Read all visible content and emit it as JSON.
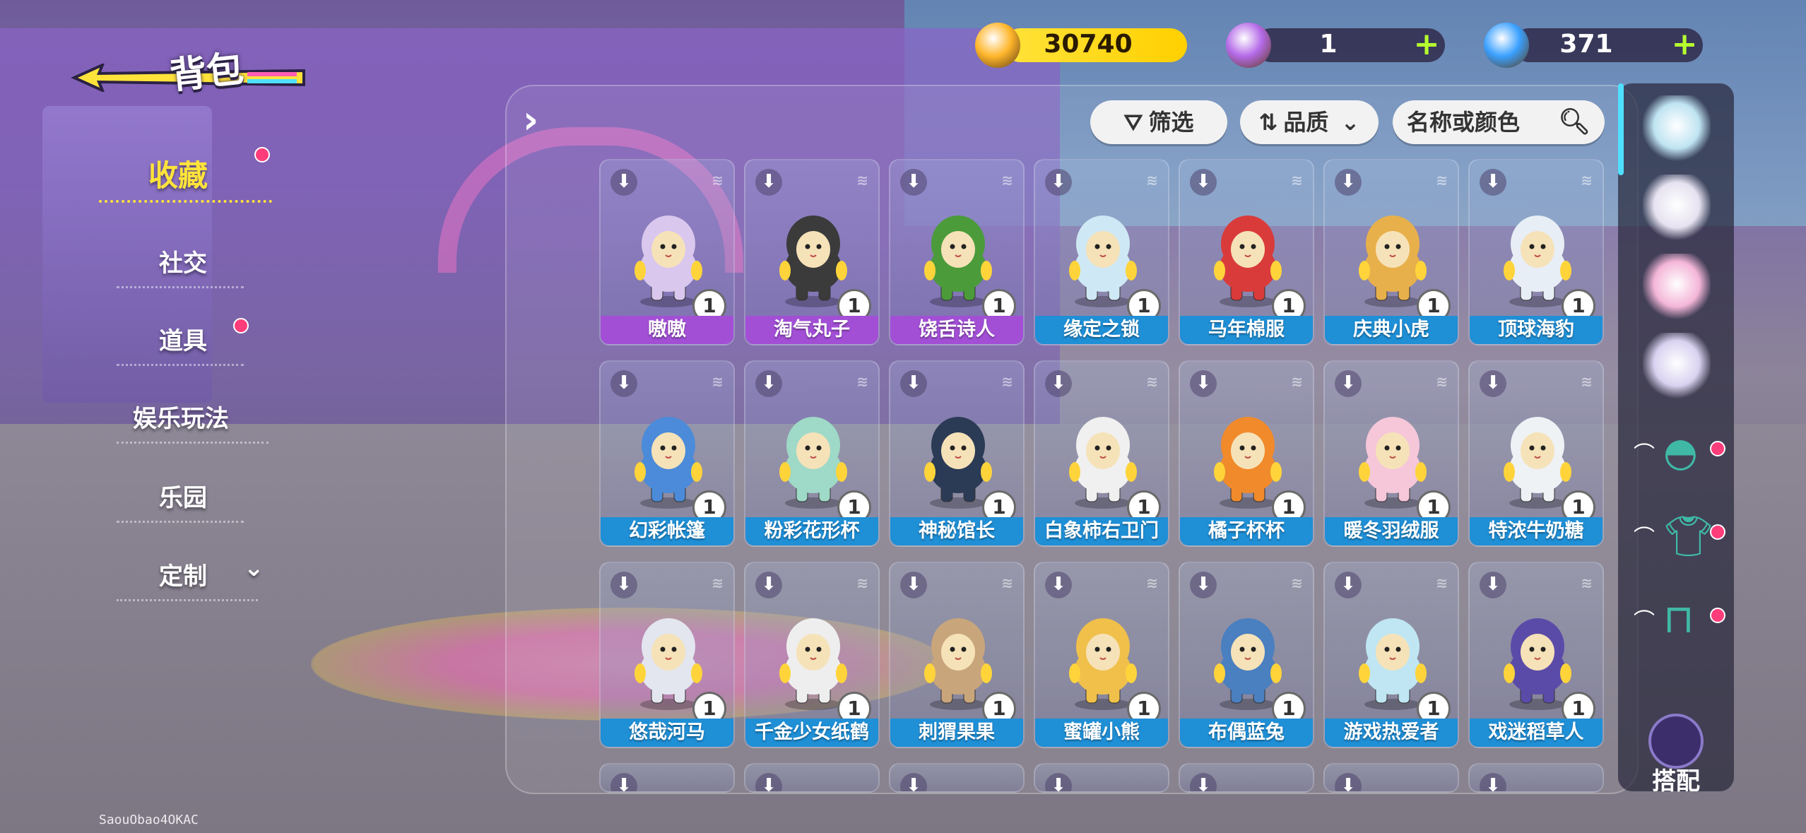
{
  "header": {
    "back_title": "背包",
    "currencies": [
      {
        "icon": "gold-star-coin-icon",
        "value": "30740",
        "has_plus": false
      },
      {
        "icon": "purple-token-icon",
        "value": "1",
        "has_plus": true,
        "plus": "+"
      },
      {
        "icon": "blue-gem-icon",
        "value": "371",
        "has_plus": true,
        "plus": "+"
      }
    ]
  },
  "sidebar": {
    "items": [
      {
        "label": "收藏",
        "selected": true,
        "badge": true
      },
      {
        "label": "社交",
        "selected": false,
        "badge": false
      },
      {
        "label": "道具",
        "selected": false,
        "badge": true
      },
      {
        "label": "娱乐玩法",
        "selected": false,
        "badge": false
      },
      {
        "label": "乐园",
        "selected": false,
        "badge": false
      },
      {
        "label": "定制",
        "selected": false,
        "badge": false,
        "expandable": true
      }
    ]
  },
  "toolbar": {
    "filter_label": "筛选",
    "sort_label": "品质",
    "search_placeholder": "名称或颜色"
  },
  "items": [
    {
      "name": "嗷嗷",
      "qty": "1",
      "rarity": "purple",
      "color": "#d9c7ee"
    },
    {
      "name": "淘气丸子",
      "qty": "1",
      "rarity": "purple",
      "color": "#3b3b3b"
    },
    {
      "name": "饶舌诗人",
      "qty": "1",
      "rarity": "purple",
      "color": "#4b9b3b"
    },
    {
      "name": "缘定之锁",
      "qty": "1",
      "rarity": "blue",
      "color": "#cfe8f5"
    },
    {
      "name": "马年棉服",
      "qty": "1",
      "rarity": "blue",
      "color": "#d93b3b"
    },
    {
      "name": "庆典小虎",
      "qty": "1",
      "rarity": "blue",
      "color": "#e8b04b"
    },
    {
      "name": "顶球海豹",
      "qty": "1",
      "rarity": "blue",
      "color": "#e8eef5"
    },
    {
      "name": "幻彩帐篷",
      "qty": "1",
      "rarity": "blue",
      "color": "#4b8bd9"
    },
    {
      "name": "粉彩花形杯",
      "qty": "1",
      "rarity": "blue",
      "color": "#9fd9c7"
    },
    {
      "name": "神秘馆长",
      "qty": "1",
      "rarity": "blue",
      "color": "#2b3a55"
    },
    {
      "name": "白象柿右卫门",
      "qty": "1",
      "rarity": "blue",
      "color": "#f0f0f0"
    },
    {
      "name": "橘子杯杯",
      "qty": "1",
      "rarity": "blue",
      "color": "#f08a2b"
    },
    {
      "name": "暖冬羽绒服",
      "qty": "1",
      "rarity": "blue",
      "color": "#f5c7d9"
    },
    {
      "name": "特浓牛奶糖",
      "qty": "1",
      "rarity": "blue",
      "color": "#eef2f5"
    },
    {
      "name": "悠哉河马",
      "qty": "1",
      "rarity": "blue",
      "color": "#e3e6ee"
    },
    {
      "name": "千金少女纸鹤",
      "qty": "1",
      "rarity": "blue",
      "color": "#eeeeee"
    },
    {
      "name": "刺猬果果",
      "qty": "1",
      "rarity": "blue",
      "color": "#c9a57c"
    },
    {
      "name": "蜜罐小熊",
      "qty": "1",
      "rarity": "blue",
      "color": "#f0c04b"
    },
    {
      "name": "布偶蓝兔",
      "qty": "1",
      "rarity": "blue",
      "color": "#4a7fc0"
    },
    {
      "name": "游戏热爱者",
      "qty": "1",
      "rarity": "blue",
      "color": "#bfe6f2"
    },
    {
      "name": "戏迷稻草人",
      "qty": "1",
      "rarity": "blue",
      "color": "#5b4ba8"
    }
  ],
  "partial_row_count": 7,
  "rail": {
    "outfits": [
      "outfit-set-icon-1",
      "outfit-set-icon-2",
      "outfit-set-icon-3",
      "outfit-set-icon-4"
    ],
    "categories": [
      {
        "icon": "hat-icon",
        "badge": true
      },
      {
        "icon": "shirt-icon",
        "badge": true
      },
      {
        "icon": "pants-icon",
        "badge": true
      }
    ],
    "match_label": "搭配"
  },
  "player_id": "SaouObao4OKAC",
  "colors": {
    "purple_label": "#a24fd6",
    "blue_label": "#1f8fd6",
    "accent_yellow": "#ffe33a",
    "badge_red": "#ff3d7a",
    "plus_green": "#b6ff2f"
  }
}
